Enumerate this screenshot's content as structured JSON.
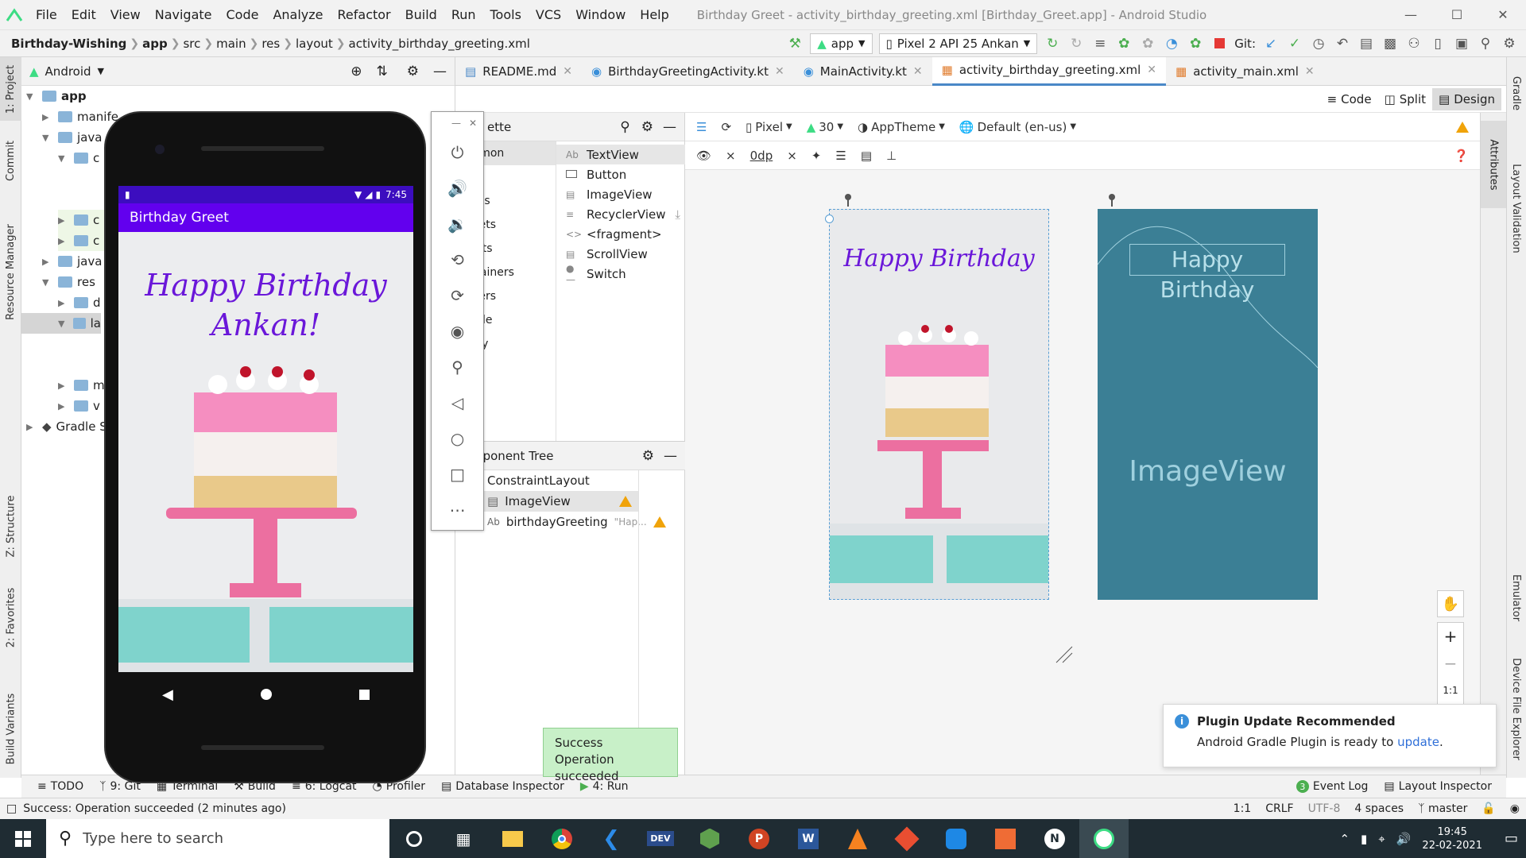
{
  "window": {
    "title": "Birthday Greet - activity_birthday_greeting.xml [Birthday_Greet.app] - Android Studio"
  },
  "menu": [
    "File",
    "Edit",
    "View",
    "Navigate",
    "Code",
    "Analyze",
    "Refactor",
    "Build",
    "Run",
    "Tools",
    "VCS",
    "Window",
    "Help"
  ],
  "breadcrumb": [
    "Birthday-Wishing",
    "app",
    "src",
    "main",
    "res",
    "layout",
    "activity_birthday_greeting.xml"
  ],
  "toolbar": {
    "config": "app",
    "device": "Pixel 2 API  25 Ankan",
    "git_label": "Git:"
  },
  "project": {
    "view": "Android",
    "items": [
      "app",
      "manife",
      "java",
      "c",
      "c",
      "c",
      "java",
      "res",
      "d",
      "la",
      "m",
      "v",
      "Gradle S"
    ]
  },
  "left_tabs": [
    "1: Project",
    "Commit",
    "Resource Manager",
    "Z: Structure",
    "2: Favorites",
    "Build Variants"
  ],
  "right_tabs": [
    "Gradle",
    "Layout Validation",
    "Emulator",
    "Device File Explorer"
  ],
  "editor_tabs": [
    "README.md",
    "BirthdayGreetingActivity.kt",
    "MainActivity.kt",
    "activity_birthday_greeting.xml",
    "activity_main.xml"
  ],
  "modes": [
    "Code",
    "Split",
    "Design"
  ],
  "palette": {
    "title": "ette",
    "categories": [
      "ommon",
      "xt",
      "ttons",
      "idgets",
      "youts",
      "ontainers",
      "elpers",
      "oogle",
      "gacy"
    ],
    "items": [
      "TextView",
      "Button",
      "ImageView",
      "RecyclerView",
      "<fragment>",
      "ScrollView",
      "Switch"
    ],
    "tags": [
      "Ab",
      "",
      "",
      "",
      "<>",
      "",
      ""
    ]
  },
  "component_tree": {
    "title": "mponent Tree",
    "rows": [
      {
        "label": "ConstraintLayout",
        "extra": ""
      },
      {
        "label": "ImageView",
        "extra": ""
      },
      {
        "label": "birthdayGreeting",
        "extra": "\"Hap..."
      }
    ]
  },
  "canvas_toolbar": {
    "device": "Pixel",
    "api": "30",
    "theme": "AppTheme",
    "locale": "Default (en-us)",
    "margin": "0dp"
  },
  "design_preview": {
    "greeting": "Happy Birthday"
  },
  "blueprint": {
    "text": "Happy Birthday",
    "image_label": "ImageView"
  },
  "zoom": {
    "fit": "1:1"
  },
  "phone": {
    "time": "7:45",
    "app_title": "Birthday Greet",
    "greeting": "Happy Birthday Ankan!"
  },
  "toast": {
    "title": "Success",
    "message": "Operation succeeded"
  },
  "notification": {
    "title": "Plugin Update Recommended",
    "text": "Android Gradle Plugin is ready to ",
    "link": "update",
    "suffix": "."
  },
  "bottom_tabs": [
    "TODO",
    "9: Git",
    "Terminal",
    "Build",
    "6: Logcat",
    "Profiler",
    "Database Inspector",
    "4: Run"
  ],
  "bottom_right": {
    "event_log": "Event Log",
    "event_count": "3",
    "layout_inspector": "Layout Inspector"
  },
  "status": {
    "message": "Success: Operation succeeded (2 minutes ago)",
    "pos": "1:1",
    "crlf": "CRLF",
    "enc": "UTF-8",
    "indent": "4 spaces",
    "branch": "master"
  },
  "taskbar": {
    "search_placeholder": "Type here to search",
    "time": "19:45",
    "date": "22-02-2021"
  },
  "colors": {
    "accent": "#4a88c7",
    "purple_status": "#3c0dbf",
    "purple_app": "#6200ee",
    "blueprint": "#3b7f95",
    "taskbar": "#1f2c33"
  }
}
